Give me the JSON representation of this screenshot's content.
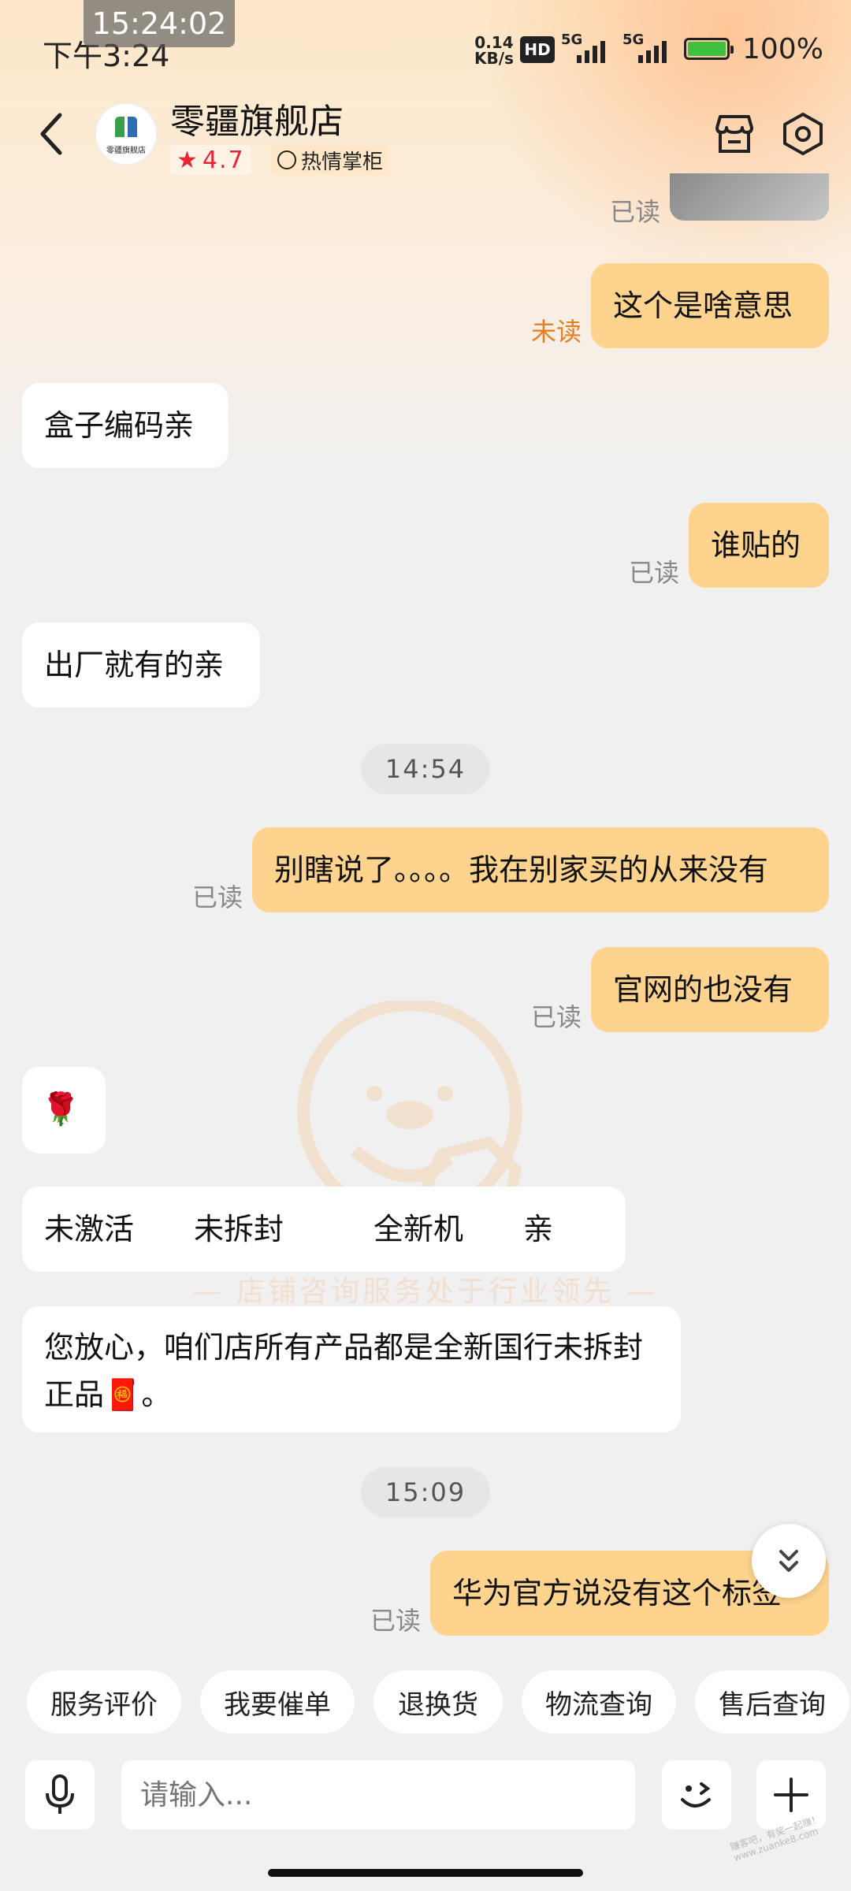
{
  "status_bar": {
    "time_overlay": "15:24:02",
    "clock": "下午3:24",
    "net_speed_value": "0.14",
    "net_speed_unit": "KB/s",
    "hd_label": "HD",
    "signal1_label": "5G",
    "signal2_label": "5G",
    "battery": "100%"
  },
  "header": {
    "shop_name": "零疆旗舰店",
    "avatar_text": "零疆旗舰店",
    "rating": "4.7",
    "badge": "热情掌柜"
  },
  "messages": [
    {
      "from": "me",
      "text": "这个是啥意思",
      "status": "未读"
    },
    {
      "from": "them",
      "text": "盒子编码亲"
    },
    {
      "from": "me",
      "text": "谁贴的",
      "status": "已读"
    },
    {
      "from": "them",
      "text": "出厂就有的亲"
    },
    {
      "from": "me",
      "text": "别瞎说了。。。。我在别家买的从来没有",
      "status": "已读"
    },
    {
      "from": "me",
      "text": "官网的也没有",
      "status": "已读"
    },
    {
      "from": "them",
      "text": "🌹"
    },
    {
      "from": "them",
      "text": "未激活　　未拆封　　　全新机　　亲"
    },
    {
      "from": "them",
      "text": "您放心，咱们店所有产品都是全新国行未拆封正品🧧。"
    },
    {
      "from": "me",
      "text": "华为官方说没有这个标签",
      "status": "已读"
    }
  ],
  "top_read_status": "已读",
  "timestamps": [
    "14:54",
    "15:09"
  ],
  "watermark_text": "— 店铺咨询服务处于行业领先 —",
  "quick_replies": [
    "服务评价",
    "我要催单",
    "退换货",
    "物流查询",
    "售后查询"
  ],
  "input": {
    "placeholder": "请输入..."
  },
  "corner_watermark": "赚客吧，有奖一起赚！ www.zuanke8.com",
  "colors": {
    "my_bubble": "#fdd38e",
    "their_bubble": "#ffffff",
    "unread": "#e67e22",
    "rating": "#ee2233"
  }
}
